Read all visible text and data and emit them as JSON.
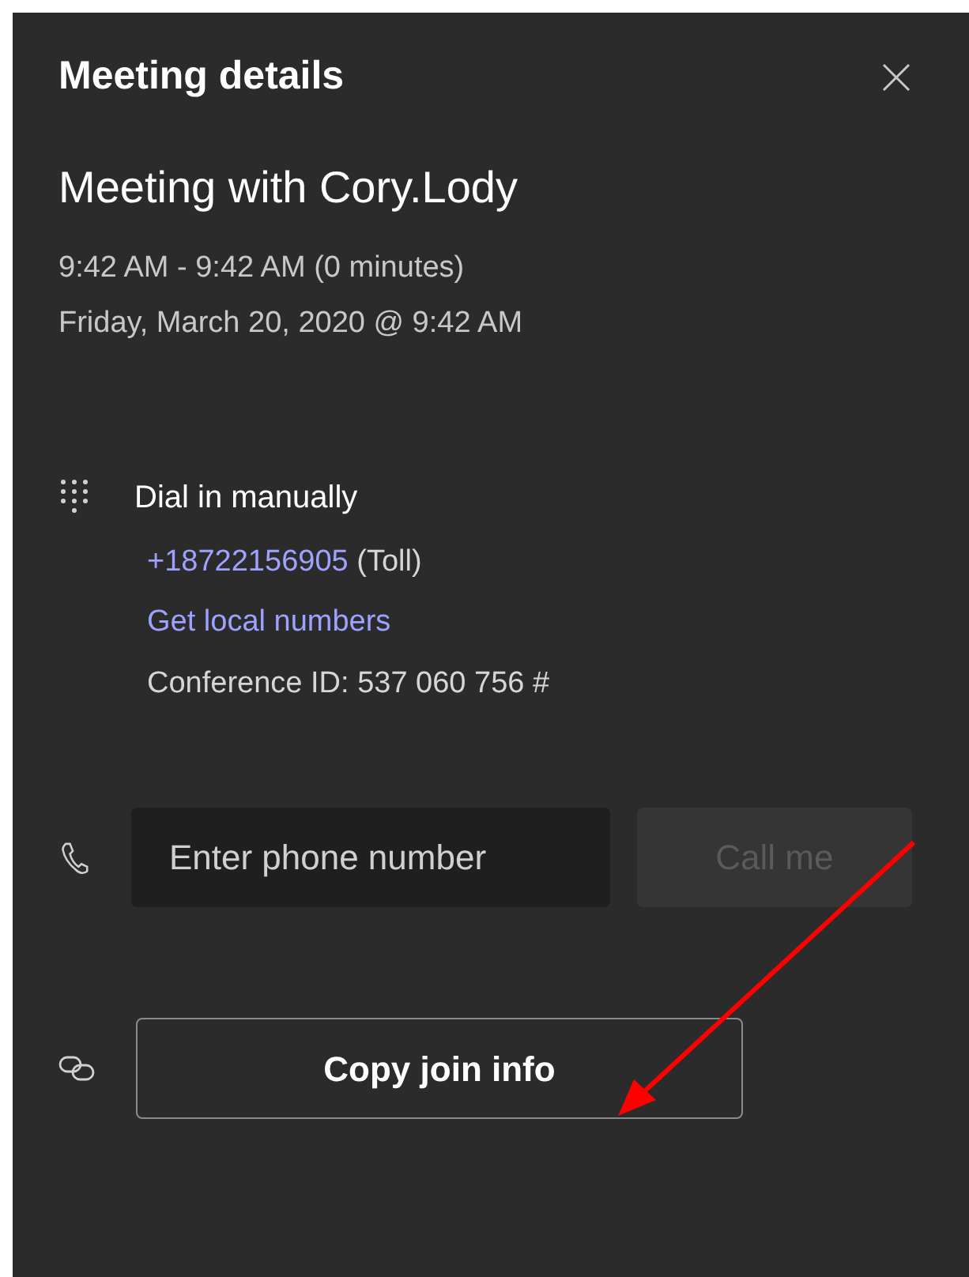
{
  "panel": {
    "title": "Meeting details"
  },
  "meeting": {
    "title": "Meeting with Cory.Lody",
    "time_range": "9:42 AM - 9:42 AM (0 minutes)",
    "date": "Friday, March 20, 2020 @ 9:42 AM"
  },
  "dial_in": {
    "heading": "Dial in manually",
    "phone_number": "+18722156905",
    "phone_note": "(Toll)",
    "local_numbers_link": "Get local numbers",
    "conference_id": "Conference ID: 537 060 756 #"
  },
  "call_me": {
    "placeholder": "Enter phone number",
    "button": {
      "label": "Call me",
      "disabled": true
    }
  },
  "copy_button": {
    "label": "Copy join info"
  }
}
